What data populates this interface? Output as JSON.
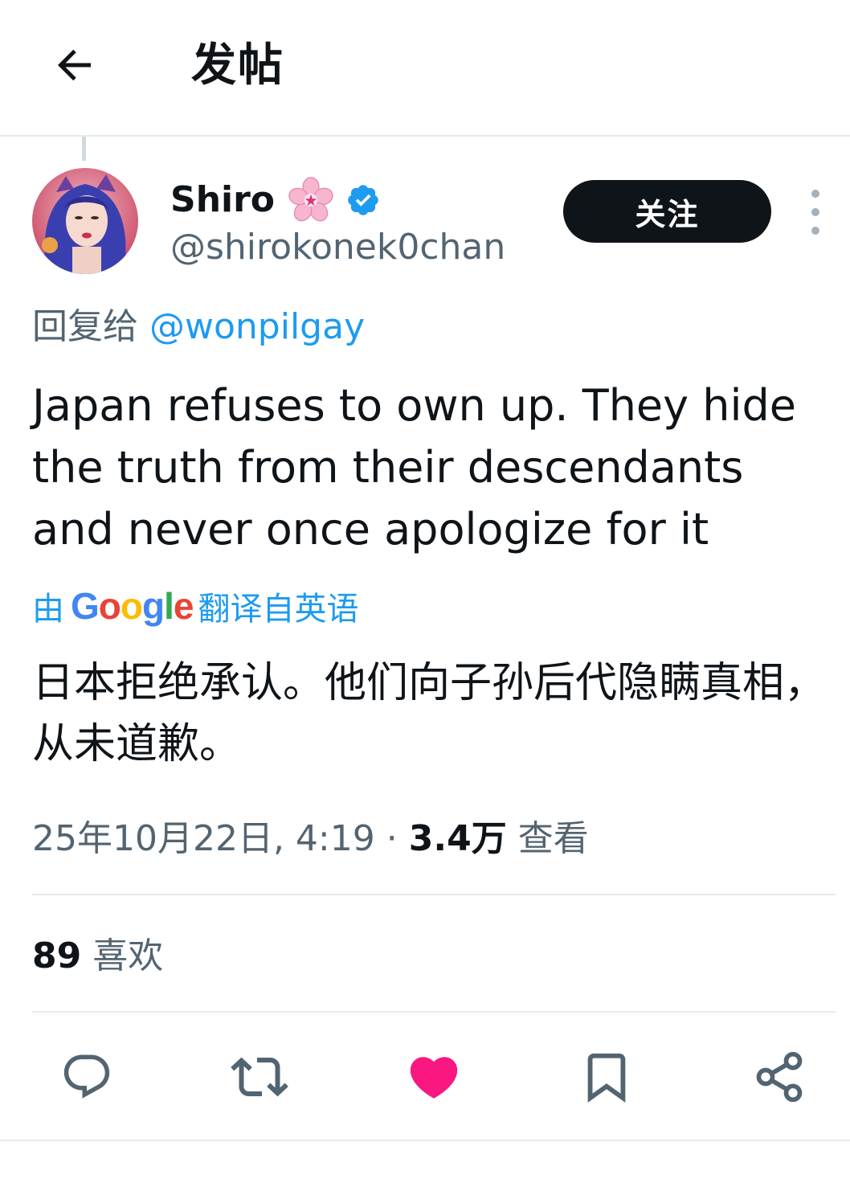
{
  "header": {
    "title": "发帖",
    "back_icon": "arrow-left-icon"
  },
  "author": {
    "display_name": "Shiro",
    "handle": "@shirokonek0chan",
    "badge_icon": "cherry-blossom-icon",
    "verified_icon": "verified-badge-icon",
    "follow_label": "关注",
    "more_icon": "more-vertical-icon"
  },
  "reply": {
    "prefix": "回复给",
    "handle": "@wonpilgay"
  },
  "tweet": {
    "text": "Japan refuses to own up. They hide the truth from their descendants and never once apologize for it",
    "translated_text": "日本拒绝承认。他们向子孙后代隐瞒真相，从未道歉。"
  },
  "translation": {
    "prefix": "由",
    "provider": "Google",
    "suffix": "翻译自英语"
  },
  "meta": {
    "date": "25年10月22日, 4:19",
    "separator": "·",
    "views_count": "3.4万",
    "views_label": "查看"
  },
  "stats": {
    "likes_count": "89",
    "likes_label": "喜欢"
  },
  "actions": [
    {
      "name": "reply",
      "icon": "comment-icon"
    },
    {
      "name": "retweet",
      "icon": "retweet-icon"
    },
    {
      "name": "like",
      "icon": "heart-icon",
      "active": true
    },
    {
      "name": "bookmark",
      "icon": "bookmark-icon"
    },
    {
      "name": "share",
      "icon": "share-icon"
    }
  ],
  "colors": {
    "accent": "#1d9bf0",
    "like": "#f91880",
    "text": "#0f1419",
    "secondary": "#536471"
  }
}
